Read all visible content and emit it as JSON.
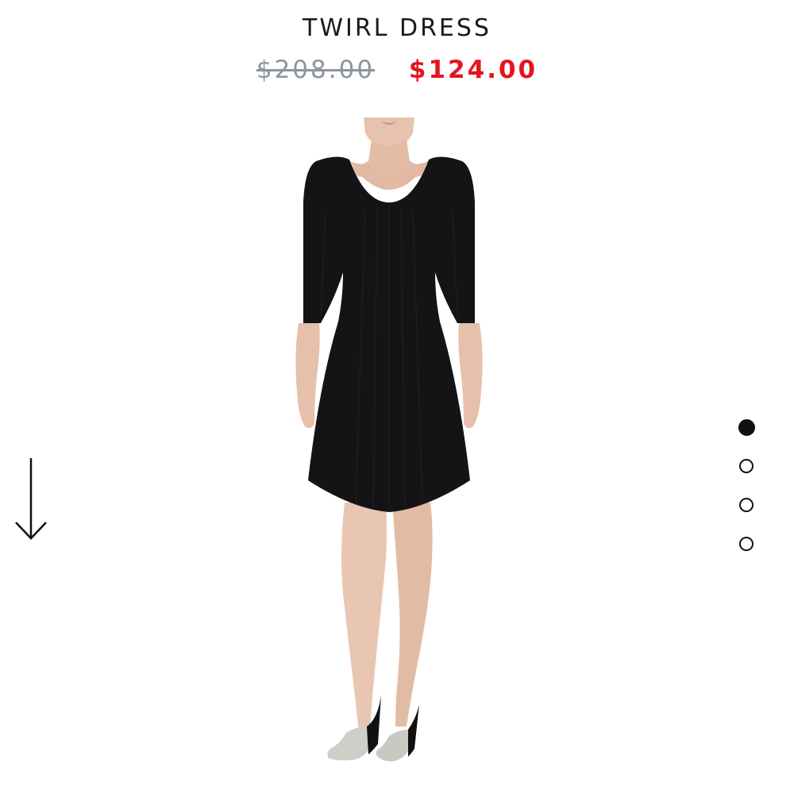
{
  "product": {
    "title": "TWIRL DRESS",
    "original_price": "$208.00",
    "sale_price": "$124.00"
  },
  "colors": {
    "sale_price": "#e4151f",
    "original_price": "#8e959c",
    "dress": "#141416"
  },
  "icons": {
    "scroll": "arrow-down-icon"
  },
  "carousel": {
    "total": 4,
    "active_index": 0
  }
}
